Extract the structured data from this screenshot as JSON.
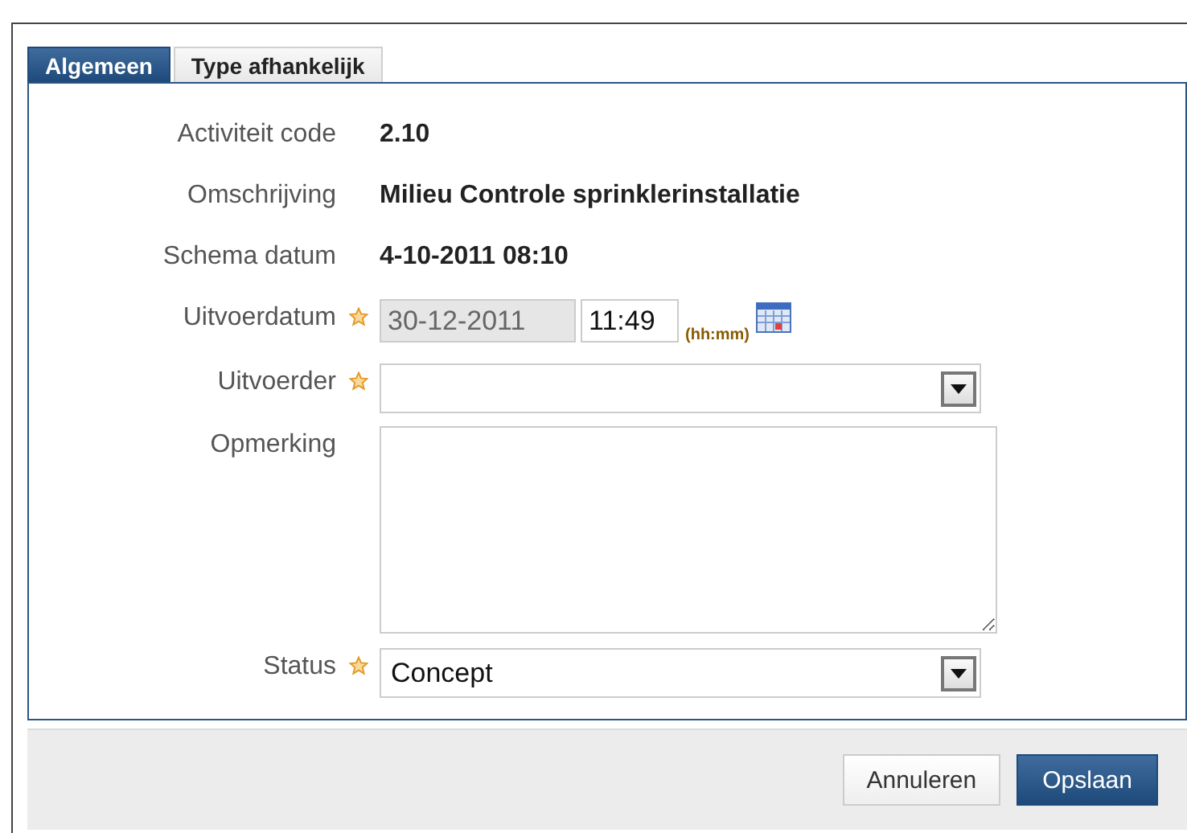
{
  "tabs": [
    {
      "label": "Algemeen",
      "selected": true
    },
    {
      "label": "Type afhankelijk",
      "selected": false
    }
  ],
  "fields": [
    {
      "kind": "readonly",
      "label": "Activiteit code",
      "value": "2.10",
      "required": false
    },
    {
      "kind": "readonly",
      "label": "Omschrijving",
      "value": "Milieu Controle sprinklerinstallatie",
      "required": false
    },
    {
      "kind": "readonly",
      "label": "Schema datum",
      "value": "4-10-2011 08:10",
      "required": false
    },
    {
      "kind": "datetime",
      "label": "Uitvoerdatum",
      "value": "30-12-2011",
      "disabled": true,
      "time": "11:49",
      "hint": "(hh:mm)",
      "required": true
    },
    {
      "kind": "select",
      "label": "Uitvoerder",
      "required": true
    },
    {
      "kind": "textarea",
      "label": "Opmerking",
      "required": false
    },
    {
      "kind": "select",
      "label": "Status",
      "value": "Concept",
      "required": true
    }
  ],
  "buttons": [
    {
      "label": "Annuleren",
      "primary": false
    },
    {
      "label": "Opslaan",
      "primary": true
    }
  ]
}
